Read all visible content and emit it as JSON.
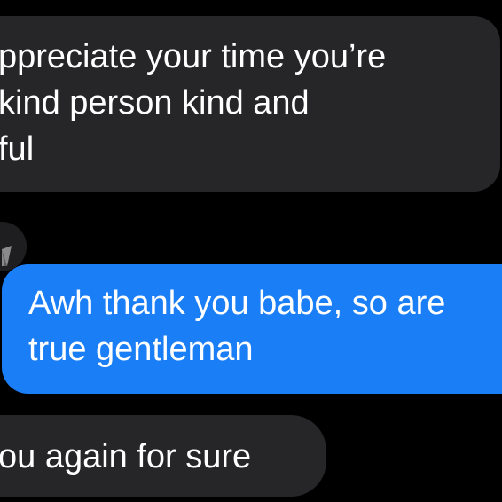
{
  "conversation": {
    "messages": [
      {
        "direction": "incoming",
        "lines": [
          "ppreciate your time you’re",
          " kind person  kind and",
          "ful"
        ]
      },
      {
        "direction": "outgoing",
        "lines": [
          "Awh thank you babe, so are",
          "true gentleman"
        ]
      },
      {
        "direction": "incoming",
        "lines": [
          "ou again for sure"
        ]
      }
    ]
  },
  "colors": {
    "background": "#000000",
    "incoming_bubble": "#262628",
    "outgoing_bubble": "#1a7ef7",
    "text": "#ffffff"
  },
  "icons": {
    "sender_avatar": "sender-avatar-icon"
  }
}
